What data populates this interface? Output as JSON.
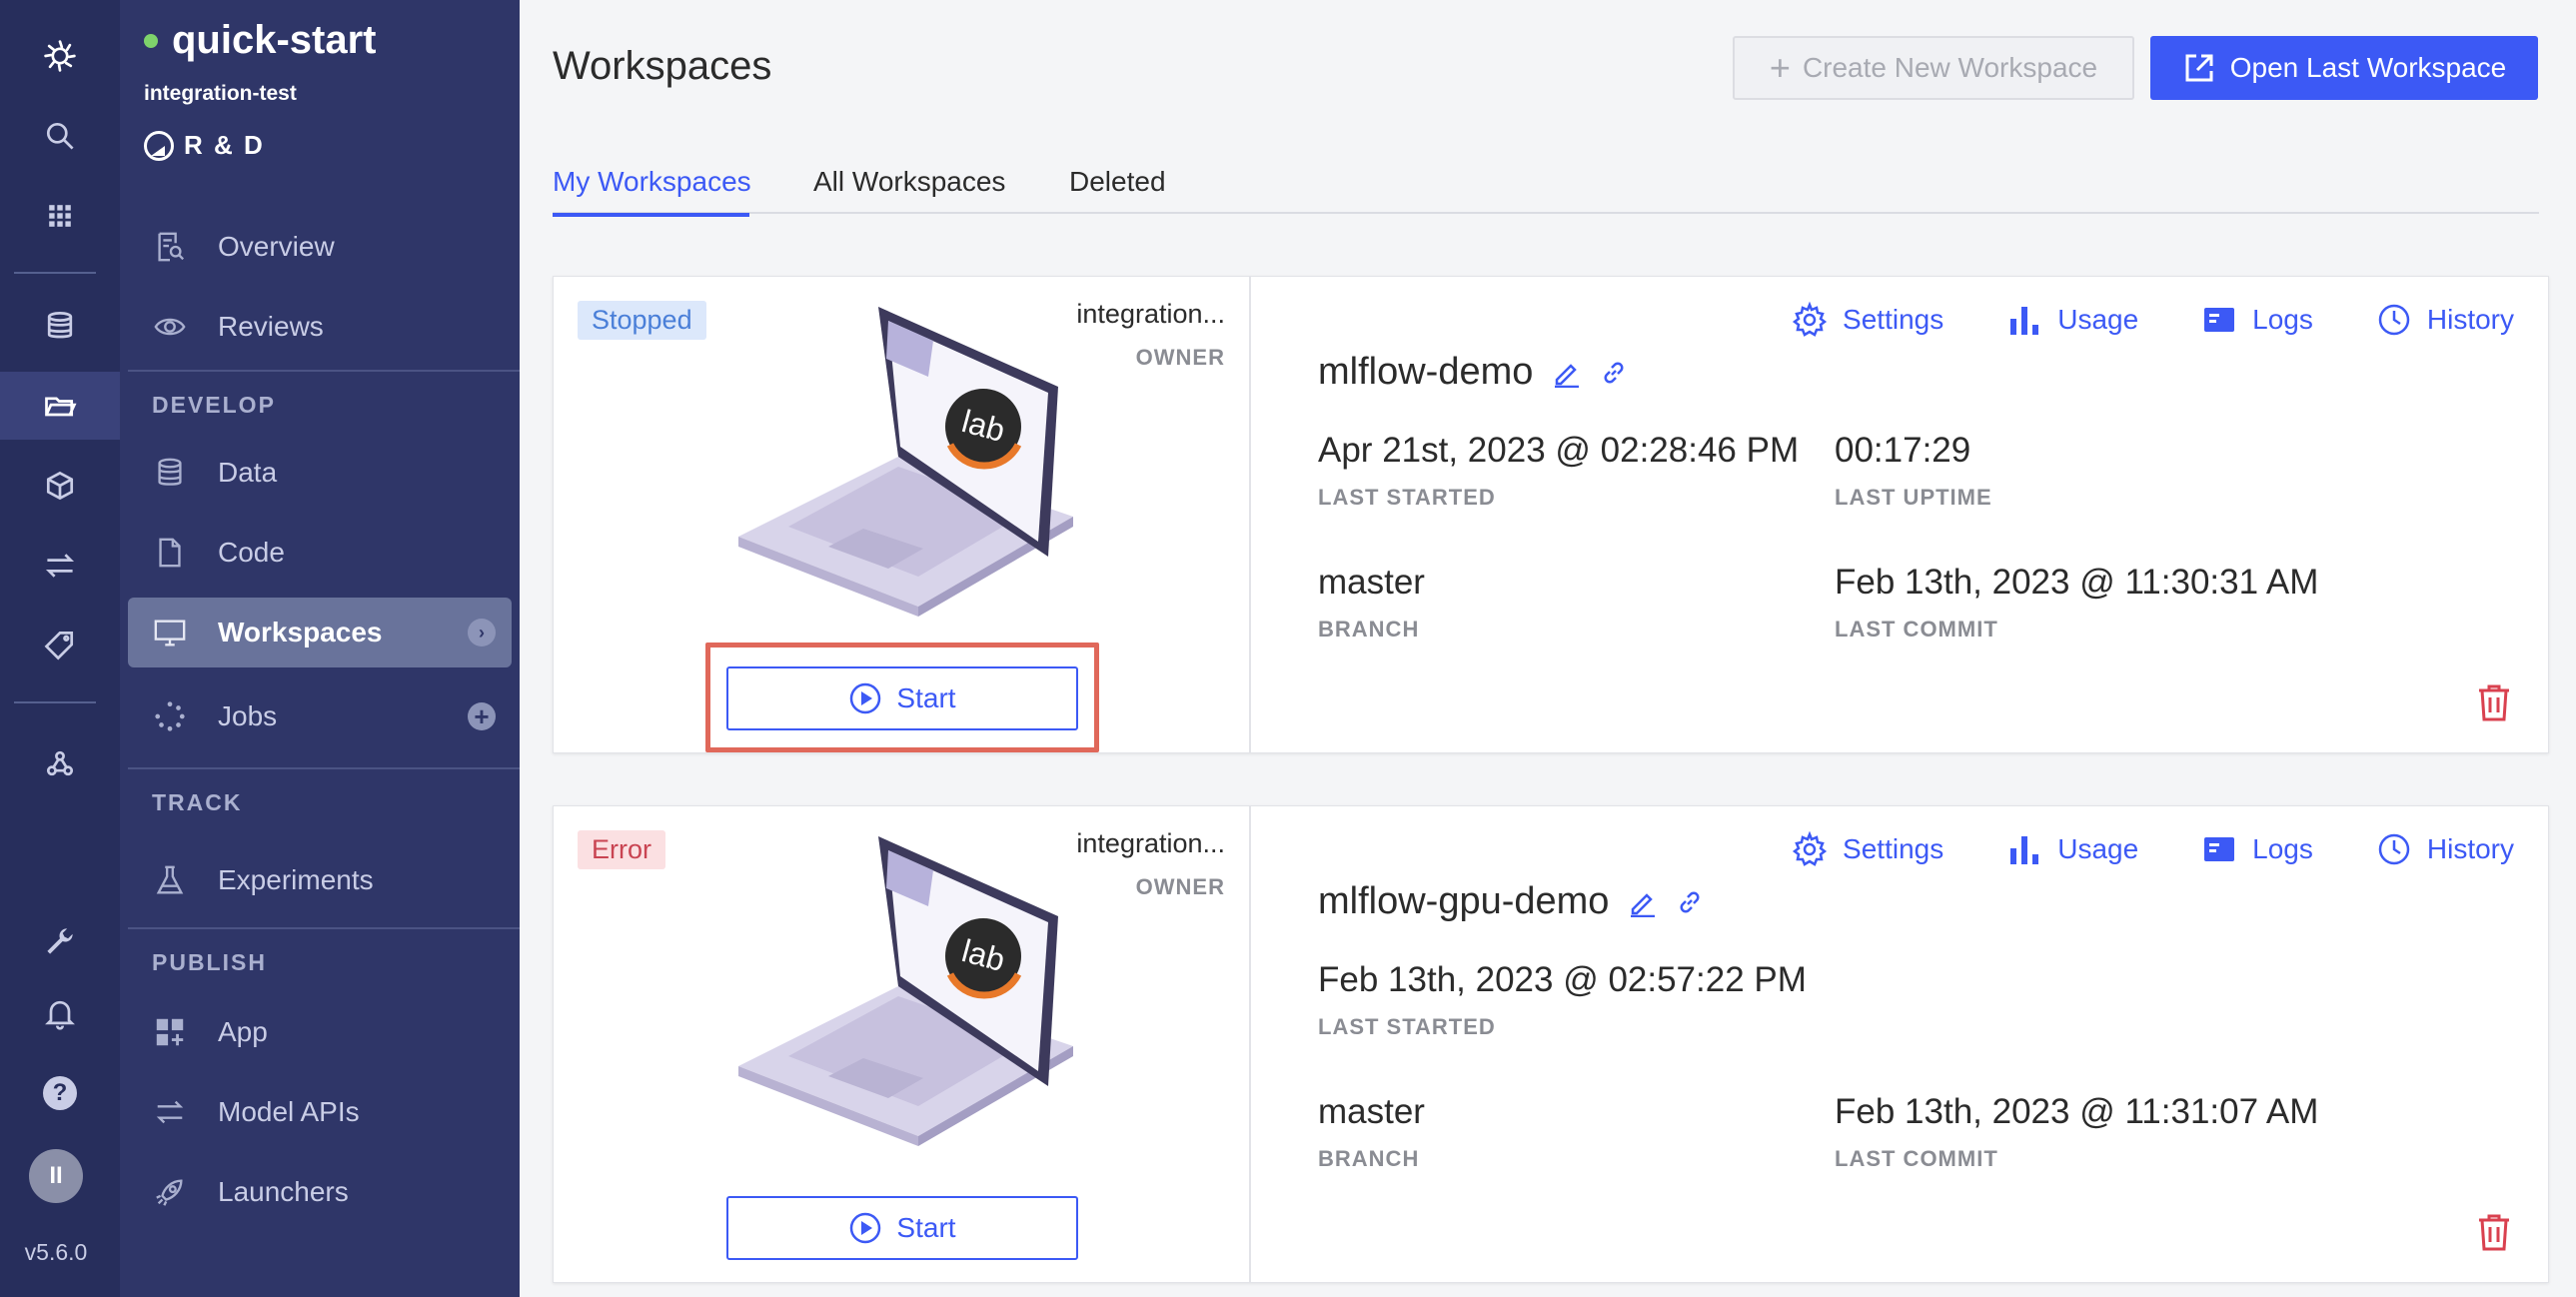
{
  "rail": {
    "version": "v5.6.0",
    "avatar_initials": "II"
  },
  "project": {
    "name": "quick-start",
    "owner": "integration-test",
    "org": "R & D"
  },
  "sidebar": {
    "items": [
      {
        "label": "Overview"
      },
      {
        "label": "Reviews"
      },
      {
        "label": "Data"
      },
      {
        "label": "Code"
      },
      {
        "label": "Workspaces"
      },
      {
        "label": "Jobs"
      },
      {
        "label": "Experiments"
      },
      {
        "label": "App"
      },
      {
        "label": "Model APIs"
      },
      {
        "label": "Launchers"
      }
    ],
    "sections": [
      "DEVELOP",
      "TRACK",
      "PUBLISH"
    ]
  },
  "header": {
    "title": "Workspaces",
    "create_label": "Create New Workspace",
    "open_last_label": "Open Last Workspace"
  },
  "tabs": [
    "My Workspaces",
    "All Workspaces",
    "Deleted"
  ],
  "workspaces": [
    {
      "status": "Stopped",
      "owner": "integration...",
      "owner_label": "OWNER",
      "name": "mlflow-demo",
      "last_started": "Apr 21st, 2023 @ 02:28:46 PM",
      "last_started_label": "LAST STARTED",
      "last_uptime": "00:17:29",
      "last_uptime_label": "LAST UPTIME",
      "branch": "master",
      "branch_label": "BRANCH",
      "last_commit": "Feb 13th, 2023 @ 11:30:31 AM",
      "last_commit_label": "LAST COMMIT",
      "start_label": "Start"
    },
    {
      "status": "Error",
      "owner": "integration...",
      "owner_label": "OWNER",
      "name": "mlflow-gpu-demo",
      "last_started": "Feb 13th, 2023 @ 02:57:22 PM",
      "last_started_label": "LAST STARTED",
      "branch": "master",
      "branch_label": "BRANCH",
      "last_commit": "Feb 13th, 2023 @ 11:31:07 AM",
      "last_commit_label": "LAST COMMIT",
      "start_label": "Start"
    }
  ],
  "actions": {
    "settings": "Settings",
    "usage": "Usage",
    "logs": "Logs",
    "history": "History"
  },
  "colors": {
    "accent": "#3c59f5",
    "rail": "#272e5c",
    "sidebar": "#2f3668",
    "highlight": "#e0685a"
  }
}
